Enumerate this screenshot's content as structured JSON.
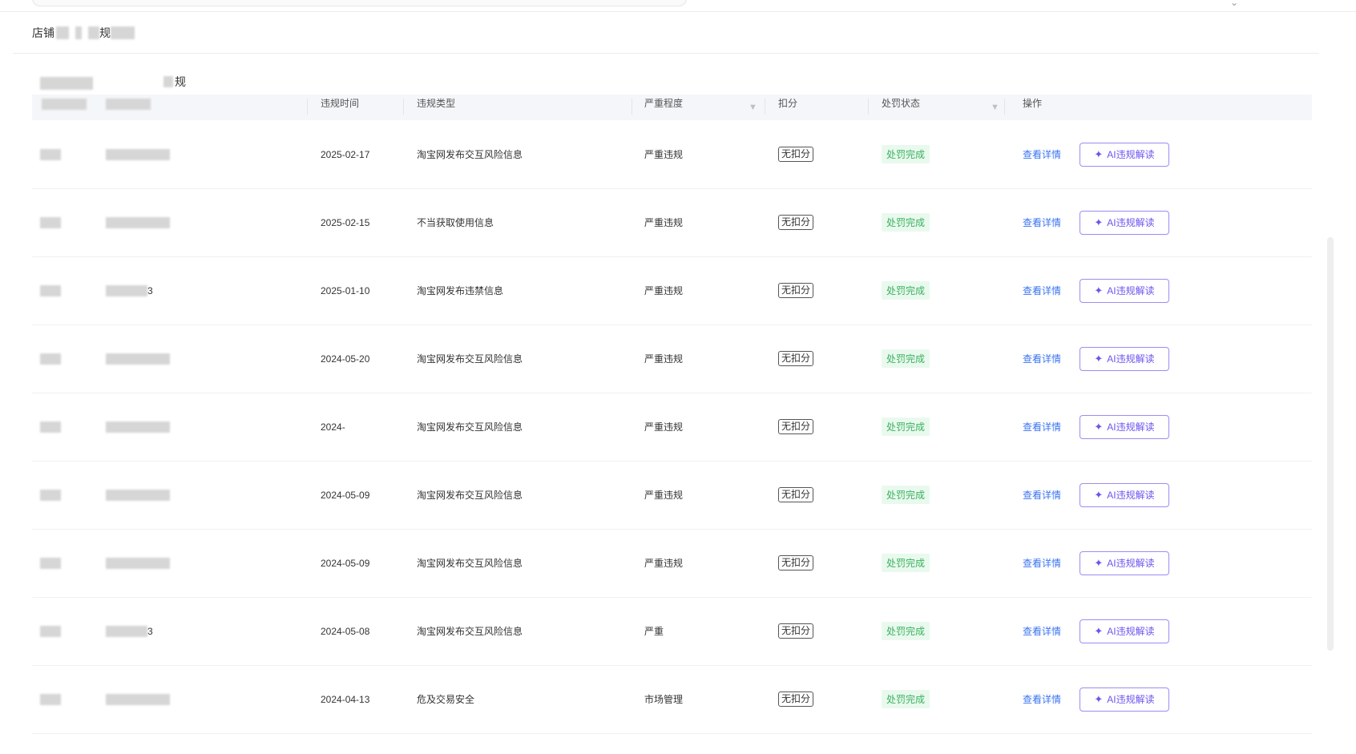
{
  "breadcrumb": {
    "prefix": "店铺",
    "mid": "规"
  },
  "tabs": {
    "active_partial": "规"
  },
  "table": {
    "headers": {
      "time": "违规时间",
      "type": "违规类型",
      "severity": "严重程度",
      "deduction": "扣分",
      "status": "处罚状态",
      "action": "操作"
    },
    "rows": [
      {
        "time": "2025-02-17",
        "type": "淘宝网发布交互风险信息",
        "severity": "严重违规",
        "deduction": "无扣分",
        "status": "处罚完成",
        "id_suffix": ""
      },
      {
        "time": "2025-02-15",
        "type": "不当获取使用信息",
        "severity": "严重违规",
        "deduction": "无扣分",
        "status": "处罚完成",
        "id_suffix": ""
      },
      {
        "time": "2025-01-10",
        "type": "淘宝网发布违禁信息",
        "severity": "严重违规",
        "deduction": "无扣分",
        "status": "处罚完成",
        "id_suffix": "3"
      },
      {
        "time": "2024-05-20",
        "type": "淘宝网发布交互风险信息",
        "severity": "严重违规",
        "deduction": "无扣分",
        "status": "处罚完成",
        "id_suffix": ""
      },
      {
        "time": "2024-",
        "type": "淘宝网发布交互风险信息",
        "severity": "严重违规",
        "deduction": "无扣分",
        "status": "处罚完成",
        "id_suffix": ""
      },
      {
        "time": "2024-05-09",
        "type": "淘宝网发布交互风险信息",
        "severity": "严重违规",
        "deduction": "无扣分",
        "status": "处罚完成",
        "id_suffix": ""
      },
      {
        "time": "2024-05-09",
        "type": "淘宝网发布交互风险信息",
        "severity": "严重违规",
        "deduction": "无扣分",
        "status": "处罚完成",
        "id_suffix": ""
      },
      {
        "time": "2024-05-08",
        "type": "淘宝网发布交互风险信息",
        "severity": "严重",
        "deduction": "无扣分",
        "status": "处罚完成",
        "id_suffix": "3"
      },
      {
        "time": "2024-04-13",
        "type": "危及交易安全",
        "severity": "市场管理",
        "deduction": "无扣分",
        "status": "处罚完成",
        "id_suffix": ""
      }
    ],
    "actions": {
      "view": "查看详情",
      "ai": "AI违规解读"
    }
  }
}
